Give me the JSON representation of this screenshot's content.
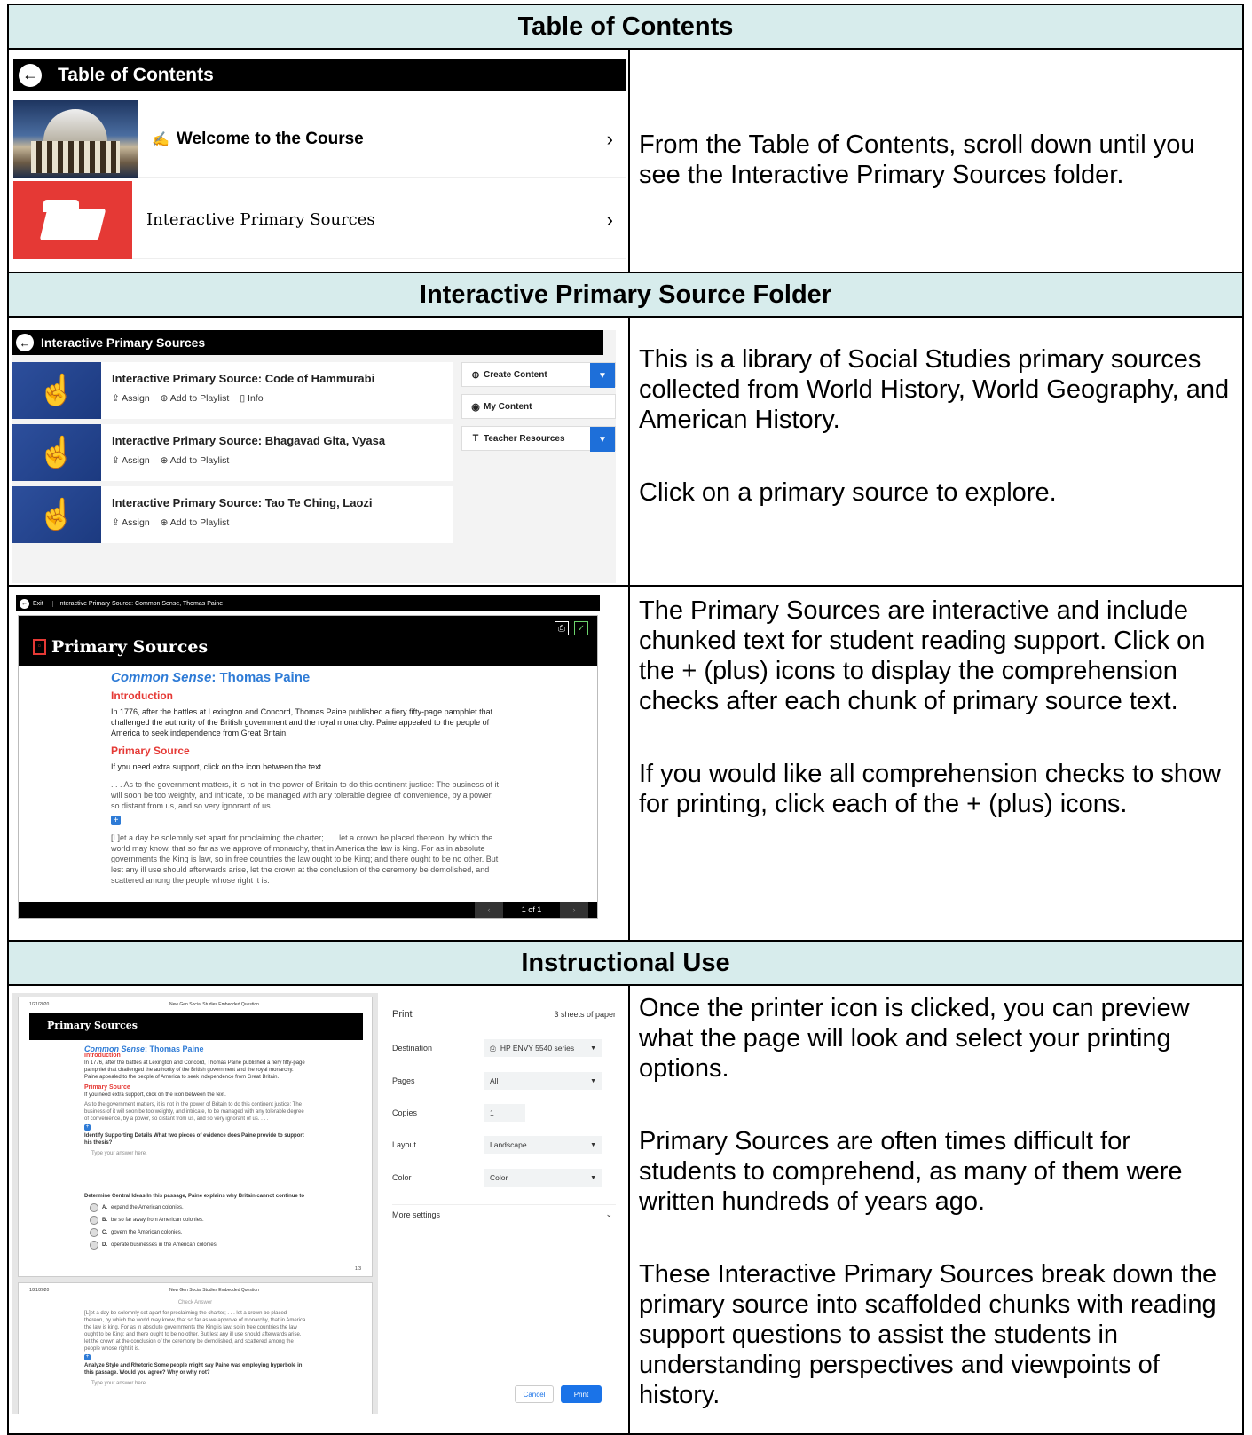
{
  "sections": {
    "toc_heading": "Table of Contents",
    "folder_heading": "Interactive Primary Source Folder",
    "instr_heading": "Instructional Use"
  },
  "toc": {
    "bar_title": "Table of Contents",
    "items": [
      {
        "label": "Welcome to the Course",
        "prefix_icon": "hand-write-icon"
      },
      {
        "label": "Interactive Primary Sources"
      }
    ],
    "description": "From the Table of Contents, scroll down until you see the Interactive Primary Sources folder."
  },
  "ips": {
    "bar_title": "Interactive Primary Sources",
    "items": [
      {
        "title": "Interactive Primary Source: Code of Hammurabi",
        "actions": [
          "Assign",
          "Add to Playlist",
          "Info"
        ]
      },
      {
        "title": "Interactive Primary Source: Bhagavad Gita, Vyasa",
        "actions": [
          "Assign",
          "Add to Playlist"
        ]
      },
      {
        "title": "Interactive Primary Source: Tao Te Ching, Laozi",
        "actions": [
          "Assign",
          "Add to Playlist"
        ]
      }
    ],
    "side_buttons": [
      "Create Content",
      "My Content",
      "Teacher Resources"
    ],
    "description_1": "This is a library of Social Studies primary sources collected from World History, World Geography, and American History.",
    "description_2": "Click on a primary source to explore."
  },
  "viewer": {
    "top_exit": "Exit",
    "top_title": "Interactive Primary Source: Common Sense, Thomas Paine",
    "header": "Primary Sources",
    "title_italic": "Common Sense",
    "title_rest": ": Thomas Paine",
    "intro_heading": "Introduction",
    "intro_text": "In 1776, after the battles at Lexington and Concord, Thomas Paine published a fiery fifty-page pamphlet that challenged the authority of the British government and the royal monarchy. Paine appealed to the people of America to seek independence from Great Britain.",
    "source_heading": "Primary Source",
    "support_text": "If you need extra support, click on the icon between the text.",
    "chunk_1": ". . . As to the government matters, it is not in the power of Britain to do this continent justice: The business of it will soon be too weighty, and intricate, to be managed with any tolerable degree of convenience, by a power, so distant from us, and so very ignorant of us. . . .",
    "chunk_2": "[L]et a day be solemnly set apart for proclaiming the charter; . . . let a crown be placed thereon, by which the world may know, that so far as we approve of monarchy, that in America the law is king. For as in absolute governments the King is law, so in free countries the law ought to be King; and there ought to be no other. But lest any ill use should afterwards arise, let the crown at the conclusion of the ceremony be demolished, and scattered among the people whose right it is.",
    "page_indicator": "1 of 1",
    "description_1": "The Primary Sources are interactive and include chunked text for student reading support. Click on the + (plus) icons to display the comprehension checks after each chunk of primary source text.",
    "description_2": "If you would like all comprehension checks to show for printing, click each of the + (plus) icons."
  },
  "print": {
    "page1": {
      "date": "1/21/2020",
      "hdr_title": "New Gen Social Studies Embedded Question",
      "header": "Primary Sources",
      "title_italic": "Common Sense",
      "title_rest": ": Thomas Paine",
      "intro_heading": "Introduction",
      "intro_text": "In 1776, after the battles at Lexington and Concord, Thomas Paine published a fiery fifty-page pamphlet that challenged the authority of the British government and the royal monarchy. Paine appealed to the people of America to seek independence from Great Britain.",
      "source_heading": "Primary Source",
      "support_text": "If you need extra support, click on the icon between the text.",
      "chunk_1": "As to the government matters, it is not in the power of Britain to do this continent justice: The business of it will soon be too weighty, and intricate, to be managed with any tolerable degree of convenience, by a power, so distant from us, and so very ignorant of us. . . .",
      "q1": "Identify Supporting Details What two pieces of evidence does Paine provide to support his thesis?",
      "answer_placeholder": "Type your answer here.",
      "q2": "Determine Central Ideas In this passage, Paine explains why Britain cannot continue to",
      "options": [
        {
          "letter": "A.",
          "text": "expand the American colonies."
        },
        {
          "letter": "B.",
          "text": "be so far away from American colonies."
        },
        {
          "letter": "C.",
          "text": "govern the American colonies."
        },
        {
          "letter": "D.",
          "text": "operate businesses in the American colonies."
        }
      ],
      "footer": "1/3"
    },
    "page2": {
      "date": "1/21/2020",
      "hdr_title": "New Gen Social Studies Embedded Question",
      "check_answer": "Check Answer",
      "chunk_2": "[L]et a day be solemnly set apart for proclaiming the charter; . . . let a crown be placed thereon, by which the world may know, that so far as we approve of monarchy, that in America the law is king. For as in absolute governments the King is law, so in free countries the law ought to be King; and there ought to be no other. But lest any ill use should afterwards arise, let the crown at the conclusion of the ceremony be demolished, and scattered among the people whose right it is.",
      "q3": "Analyze Style and Rhetoric Some people might say Paine was employing hyperbole in this passage. Would you agree? Why or why not?",
      "answer_placeholder": "Type your answer here."
    },
    "panel": {
      "title": "Print",
      "sheets": "3 sheets of paper",
      "rows": [
        {
          "label": "Destination",
          "value": "HP ENVY 5540 series"
        },
        {
          "label": "Pages",
          "value": "All"
        },
        {
          "label": "Copies",
          "value": "1"
        },
        {
          "label": "Layout",
          "value": "Landscape"
        },
        {
          "label": "Color",
          "value": "Color"
        }
      ],
      "more_settings": "More settings",
      "cancel": "Cancel",
      "print": "Print"
    },
    "description_1": "Once the printer icon is clicked, you can preview what the page will look and select your printing options.",
    "description_2": "Primary Sources are often times difficult for students to comprehend, as many of them were written hundreds of years ago.",
    "description_3": "These Interactive Primary Sources break down the primary source into scaffolded chunks with reading support questions to assist the students in understanding perspectives and viewpoints of history."
  }
}
